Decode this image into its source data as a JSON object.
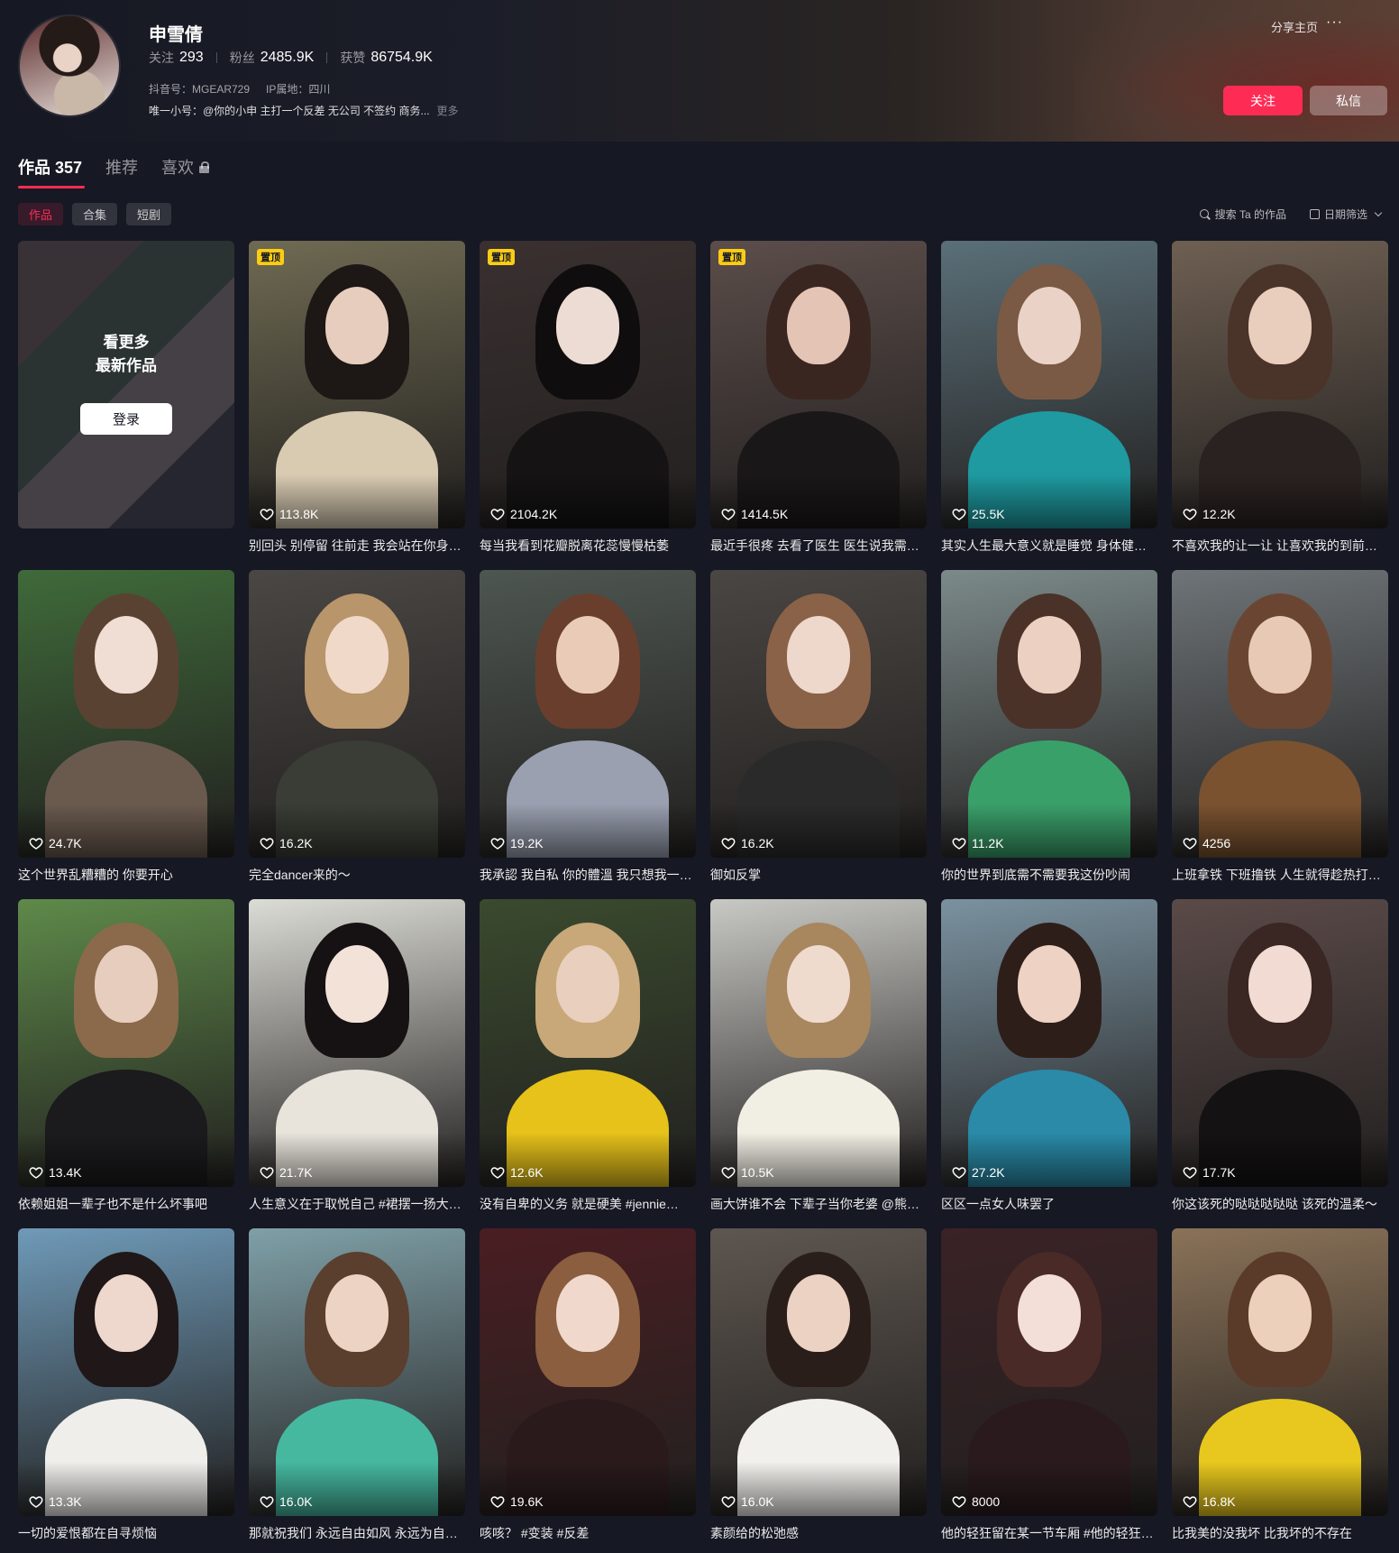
{
  "profile": {
    "name": "申雪倩",
    "follow_label": "关注",
    "follow_count": "293",
    "fans_label": "粉丝",
    "fans_count": "2485.9K",
    "likes_label": "获赞",
    "likes_count": "86754.9K",
    "douyin_id": "抖音号：MGEAR729",
    "ip": "IP属地：四川",
    "bio": "唯一小号：@你的小申 主打一个反差 无公司 不签约 商务...",
    "bio_more": "更多",
    "share_label": "分享主页",
    "more_label": "···",
    "follow_button": "关注",
    "message_button": "私信"
  },
  "tabs": [
    {
      "label": "作品 357",
      "active": true
    },
    {
      "label": "推荐",
      "active": false
    },
    {
      "label": "喜欢",
      "active": false,
      "locked": true
    }
  ],
  "filters": [
    {
      "label": "作品",
      "active": true
    },
    {
      "label": "合集",
      "active": false
    },
    {
      "label": "短剧",
      "active": false
    }
  ],
  "tools": {
    "search_label": "搜索 Ta 的作品",
    "date_filter_label": "日期筛选"
  },
  "login_card": {
    "line1": "看更多",
    "line2": "最新作品",
    "button": "登录"
  },
  "pin_label": "置顶",
  "videos": [
    {
      "likes": "113.8K",
      "caption": "别回头 别停留 往前走 我会站在你身…",
      "pinned": true,
      "bg": "#6f6a52",
      "hair": "#1d1716",
      "skin": "#e7cdbd",
      "cloth": "#d8cbb2"
    },
    {
      "likes": "2104.2K",
      "caption": "每当我看到花瓣脱离花蕊慢慢枯萎",
      "pinned": true,
      "bg": "#3a3030",
      "hair": "#0f0d0e",
      "skin": "#eddcd4",
      "cloth": "#151314"
    },
    {
      "likes": "1414.5K",
      "caption": "最近手很疼 去看了医生 医生说我需…",
      "pinned": true,
      "bg": "#5b4d4a",
      "hair": "#3a2620",
      "skin": "#e4c4b4",
      "cloth": "#1a1718"
    },
    {
      "likes": "25.5K",
      "caption": "其实人生最大意义就是睡觉 身体健…",
      "pinned": false,
      "bg": "#5a6f78",
      "hair": "#7a5a44",
      "skin": "#ead3c6",
      "cloth": "#1e9aa0"
    },
    {
      "likes": "12.2K",
      "caption": "不喜欢我的让一让 让喜欢我的到前…",
      "pinned": false,
      "bg": "#6e5f52",
      "hair": "#4a3328",
      "skin": "#e9cdbd",
      "cloth": "#2a2220"
    },
    {
      "likes": "24.7K",
      "caption": "这个世界乱糟糟的 你要开心",
      "pinned": false,
      "bg": "#3f6a3a",
      "hair": "#5a4232",
      "skin": "#f0ddd3",
      "cloth": "#6a5a4e"
    },
    {
      "likes": "16.2K",
      "caption": "完全dancer来的～",
      "pinned": false,
      "bg": "#4a4744",
      "hair": "#b8956a",
      "skin": "#f0d9c8",
      "cloth": "#3a3d35"
    },
    {
      "likes": "19.2K",
      "caption": "我承認 我自私 你的體溫 我只想我一…",
      "pinned": false,
      "bg": "#4e5650",
      "hair": "#6a3e2c",
      "skin": "#e9cbb8",
      "cloth": "#9aa0b0"
    },
    {
      "likes": "16.2K",
      "caption": "御如反掌",
      "pinned": false,
      "bg": "#4a4643",
      "hair": "#8a6248",
      "skin": "#eed7cb",
      "cloth": "#2a2a2a"
    },
    {
      "likes": "11.2K",
      "caption": "你的世界到底需不需要我这份吵闹",
      "pinned": false,
      "bg": "#7c8a8a",
      "hair": "#4a3228",
      "skin": "#ecd0c2",
      "cloth": "#3aa06a"
    },
    {
      "likes": "4256",
      "caption": "上班拿铁 下班撸铁 人生就得趁热打…",
      "pinned": false,
      "bg": "#6e7478",
      "hair": "#6a4632",
      "skin": "#e8c9b6",
      "cloth": "#7a5230"
    },
    {
      "likes": "13.4K",
      "caption": "依赖姐姐一辈子也不是什么坏事吧",
      "pinned": false,
      "bg": "#5e8a4a",
      "hair": "#8a6a4a",
      "skin": "#e6cdbd",
      "cloth": "#1b1a1c"
    },
    {
      "likes": "21.7K",
      "caption": "人生意义在于取悦自己 #裙摆一扬大…",
      "pinned": false,
      "bg": "#dcdcd6",
      "hair": "#161214",
      "skin": "#f3e2d8",
      "cloth": "#e8e4dc"
    },
    {
      "likes": "12.6K",
      "caption": "没有自卑的义务 就是硬美 #jennie…",
      "pinned": false,
      "bg": "#3a4a2e",
      "hair": "#c8a878",
      "skin": "#e9cfbe",
      "cloth": "#e6c21a"
    },
    {
      "likes": "10.5K",
      "caption": "画大饼谁不会 下辈子当你老婆 @熊…",
      "pinned": false,
      "bg": "#c8c8c4",
      "hair": "#a8865e",
      "skin": "#efdace",
      "cloth": "#f1efe4"
    },
    {
      "likes": "27.2K",
      "caption": "区区一点女人味罢了",
      "pinned": false,
      "bg": "#7a92a0",
      "hair": "#2e1e1a",
      "skin": "#eed2c4",
      "cloth": "#2a8aa8"
    },
    {
      "likes": "17.7K",
      "caption": "你这该死的哒哒哒哒哒 该死的温柔～",
      "pinned": false,
      "bg": "#5a4a48",
      "hair": "#3a2622",
      "skin": "#f2dbd2",
      "cloth": "#141212"
    },
    {
      "likes": "13.3K",
      "caption": "一切的爱恨都在自寻烦恼",
      "pinned": false,
      "bg": "#6f9ab8",
      "hair": "#1f1718",
      "skin": "#eed7cc",
      "cloth": "#f0eeea"
    },
    {
      "likes": "16.0K",
      "caption": "那就祝我们 永远自由如风 永远为自…",
      "pinned": false,
      "bg": "#7fa0a8",
      "hair": "#5a3e2e",
      "skin": "#ecd3c4",
      "cloth": "#46b8a0"
    },
    {
      "likes": "19.6K",
      "caption": "咳咳？ #变装 #反差",
      "pinned": false,
      "bg": "#4a1e22",
      "hair": "#8a5e3e",
      "skin": "#f0d8cc",
      "cloth": "#2a1a1c"
    },
    {
      "likes": "16.0K",
      "caption": "素颜给的松弛感",
      "pinned": false,
      "bg": "#5e5650",
      "hair": "#2a1e1a",
      "skin": "#ecd2c2",
      "cloth": "#f2f0ec"
    },
    {
      "likes": "8000",
      "caption": "他的轻狂留在某一节车厢 #他的轻狂…",
      "pinned": false,
      "bg": "#3a2226",
      "hair": "#4a2a26",
      "skin": "#f3dfd8",
      "cloth": "#2a1a1e"
    },
    {
      "likes": "16.8K",
      "caption": "比我美的没我坏 比我坏的不存在",
      "pinned": false,
      "bg": "#8a7258",
      "hair": "#5a3a28",
      "skin": "#ecd0bc",
      "cloth": "#e8c81e"
    }
  ]
}
